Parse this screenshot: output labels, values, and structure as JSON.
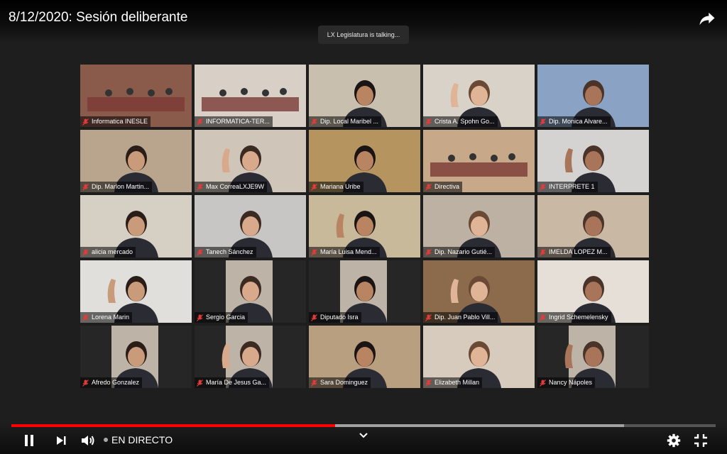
{
  "video": {
    "title": "8/12/2020: Sesión deliberante",
    "talking_indicator": "LX Legislatura is talking...",
    "live_label": "EN DIRECTO",
    "progress_played": 0.46,
    "progress_buffered": 0.87
  },
  "participants": [
    {
      "name": "Informatica INESLE",
      "bg": "#8a5a4a"
    },
    {
      "name": "INFORMATICA-TER...",
      "bg": "#d8d0c6"
    },
    {
      "name": "Dip. Local Maribel ...",
      "bg": "#c9bfae"
    },
    {
      "name": "Crista A. Spohn Go...",
      "bg": "#d9d2c8"
    },
    {
      "name": "Dip. Monica Alvare...",
      "bg": "#8aa3c4"
    },
    {
      "name": "Dip. Marlon Martin...",
      "bg": "#b9a48e"
    },
    {
      "name": "Max CorreaLXJE9W",
      "bg": "#cfc5b8"
    },
    {
      "name": "Mariana Uribe",
      "bg": "#b6945f"
    },
    {
      "name": "Directiva",
      "bg": "#c7a98a"
    },
    {
      "name": "INTERPRETE 1",
      "bg": "#d5d3d2"
    },
    {
      "name": "alicia mercado",
      "bg": "#d6cfc3"
    },
    {
      "name": "Tanech Sánchez",
      "bg": "#c8c6c4"
    },
    {
      "name": "María Luisa Mend...",
      "bg": "#c9b99b"
    },
    {
      "name": "Dip. Nazario Gutié...",
      "bg": "#bdb1a4"
    },
    {
      "name": "IMELDA LOPEZ M...",
      "bg": "#c9b8a4"
    },
    {
      "name": "Lorena Marin",
      "bg": "#e1dfdc"
    },
    {
      "name": "Sergio Garcia",
      "bg": "#262626"
    },
    {
      "name": "Diputado Isra",
      "bg": "#262626"
    },
    {
      "name": "Dip. Juan Pablo Vill...",
      "bg": "#8c6a4c"
    },
    {
      "name": "Ingrid Schemelensky",
      "bg": "#e6dfd8"
    },
    {
      "name": "Afredo Gonzalez",
      "bg": "#262626"
    },
    {
      "name": "María De Jesus Ga...",
      "bg": "#262626"
    },
    {
      "name": "Sara Dominguez",
      "bg": "#b89f7f"
    },
    {
      "name": "Elizabeth Millan",
      "bg": "#d7cbbd"
    },
    {
      "name": "Nancy Nápoles",
      "bg": "#262626"
    }
  ],
  "colors": {
    "accent_red": "#ff0000",
    "mic_muted": "#e23b3b"
  }
}
